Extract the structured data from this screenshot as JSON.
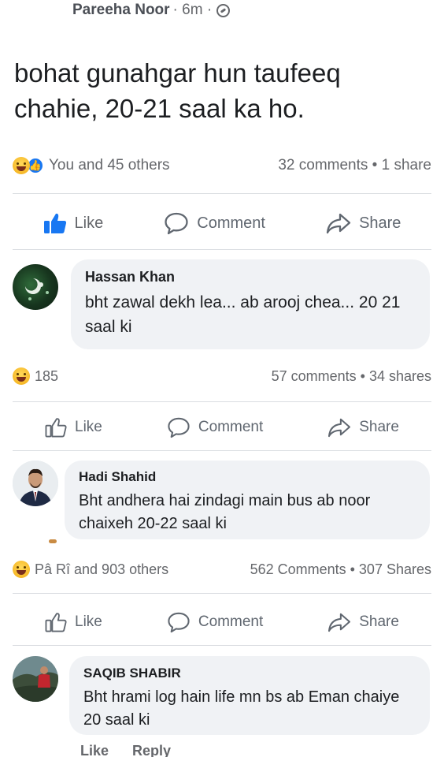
{
  "post": {
    "author": "Pareeha Noor",
    "time": "· 6m ·",
    "text": "bohat gunahgar hun taufeeq chahie, 20-21 saal ka ho.",
    "reactions": "You and 45 others",
    "stats": "32 comments • 1 share",
    "actions": {
      "like": "Like",
      "comment": "Comment",
      "share": "Share"
    }
  },
  "comment1": {
    "name": "Hassan Khan",
    "text": "bht zawal dekh lea... ab arooj chea... 20 21 saal ki",
    "reactions": "185",
    "stats": "57 comments • 34 shares",
    "actions": {
      "like": "Like",
      "comment": "Comment",
      "share": "Share"
    }
  },
  "comment2": {
    "name": "Hadi Shahid",
    "text": "Bht andhera hai zindagi main bus ab noor chaixeh 20-22 saal ki",
    "reactions": "Pâ Rî and 903 others",
    "stats": "562 Comments • 307 Shares",
    "actions": {
      "like": "Like",
      "comment": "Comment",
      "share": "Share"
    }
  },
  "comment3": {
    "name": "SAQIB SHABIR",
    "text": "Bht hrami log hain life mn bs ab Eman chaiye 20 saal ki",
    "like": "Like",
    "reply": "Reply"
  },
  "colors": {
    "accent": "#1877f2",
    "bubble": "#f0f2f5",
    "muted": "#65676b"
  },
  "icons": [
    "globe-icon",
    "haha-emoji-icon",
    "like-badge-icon",
    "thumbs-up-icon",
    "comment-icon",
    "share-icon"
  ]
}
